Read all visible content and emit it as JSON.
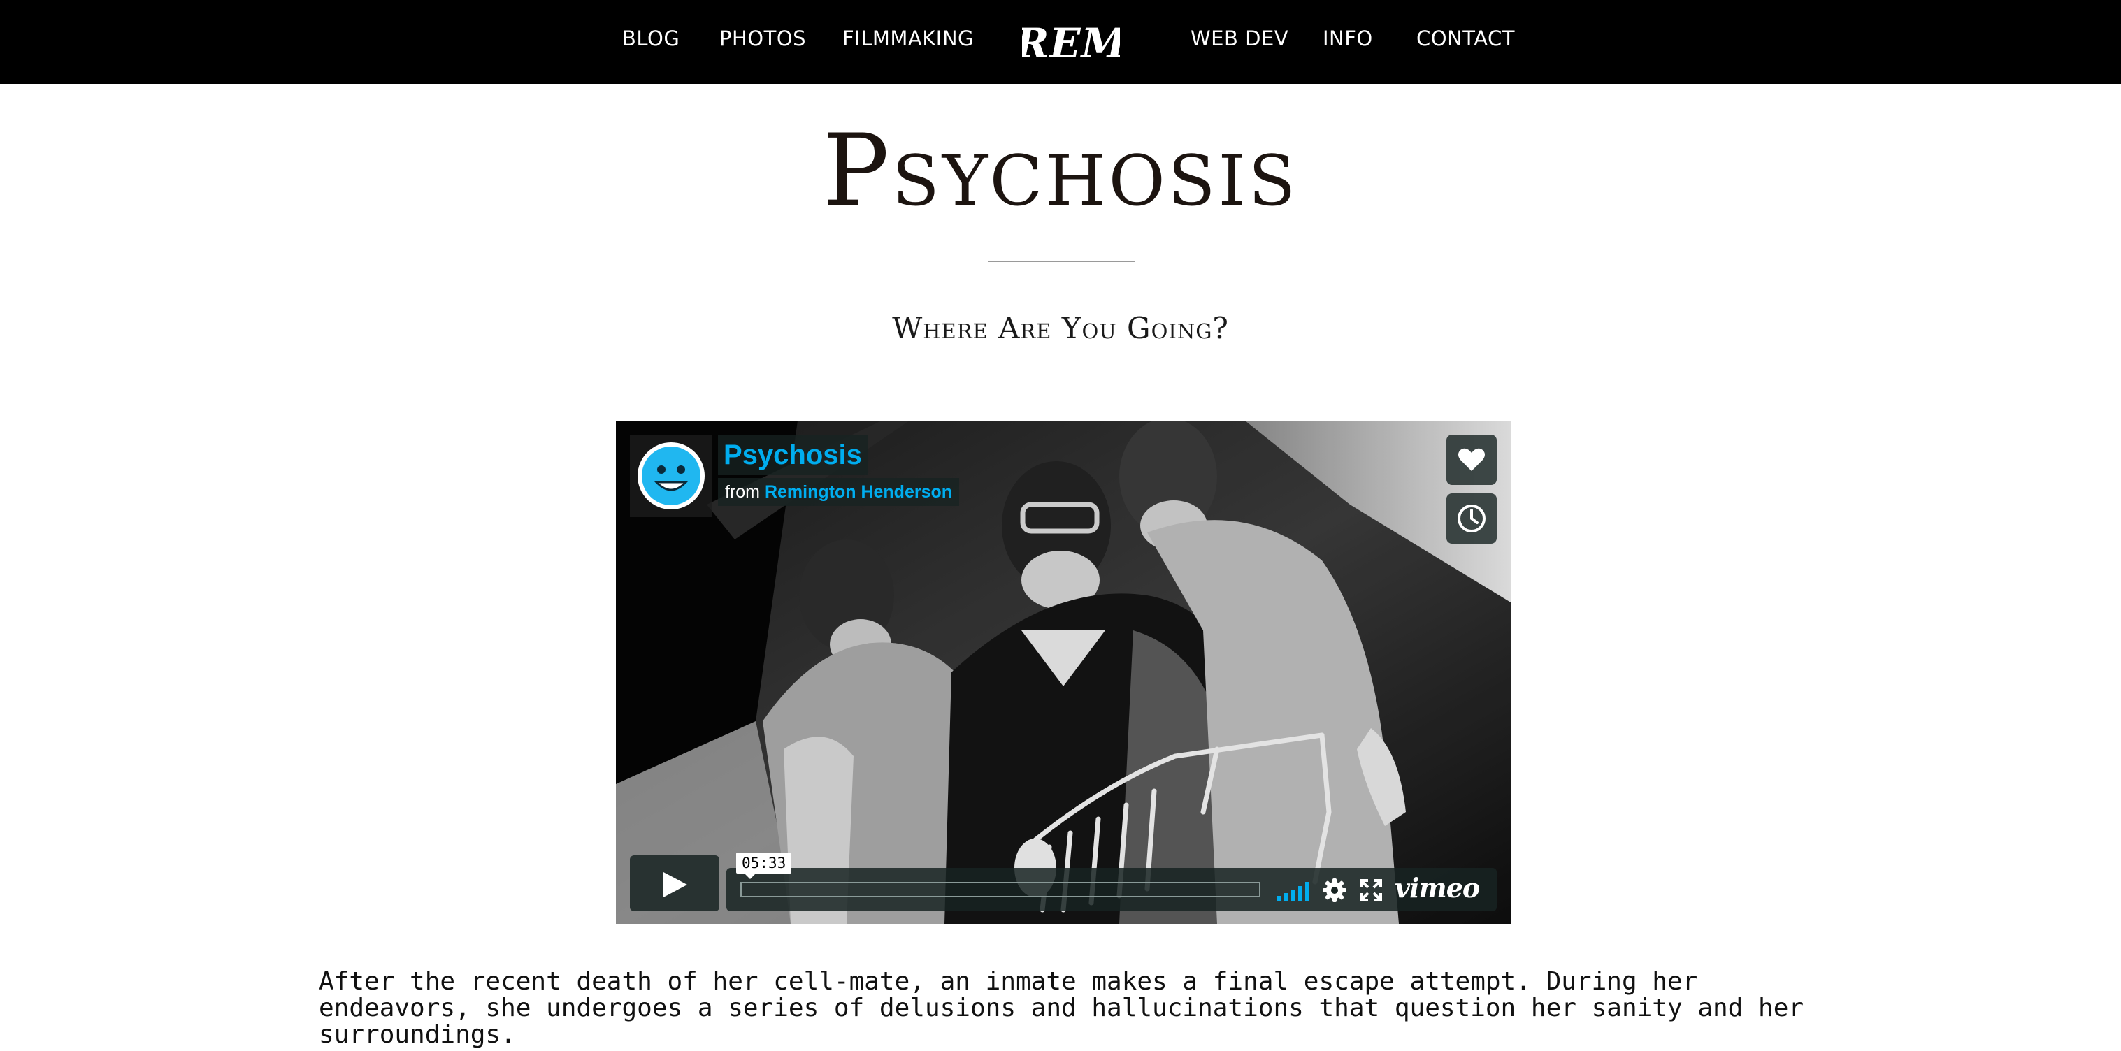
{
  "nav": {
    "left_links": [
      "BLOG",
      "PHOTOS",
      "FILMMAKING"
    ],
    "logo_text": "REM",
    "right_links": [
      "WEB DEV",
      "INFO",
      "CONTACT"
    ]
  },
  "page": {
    "title": "Psychosis",
    "subtitle": "Where Are You Going?"
  },
  "player": {
    "video_title": "Psychosis",
    "byline_prefix": "from",
    "author": "Remington Henderson",
    "duration": "05:33",
    "progress": 0,
    "brand": "vimeo",
    "accent_color": "#00adef",
    "icons": [
      "heart-icon",
      "clock-icon",
      "play-icon",
      "volume-icon",
      "gear-icon",
      "fullscreen-icon"
    ]
  },
  "description": "After the recent death of her cell-mate, an inmate makes a final escape attempt. During her endeavors, she undergoes a series of delusions and hallucinations that question her sanity and her surroundings."
}
